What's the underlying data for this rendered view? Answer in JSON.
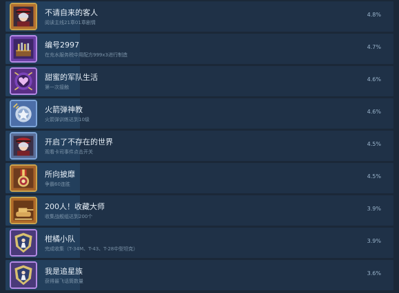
{
  "achievements": [
    {
      "title": "不请自来的客人",
      "desc": "阅读主线21章01章剧情",
      "percent": "4.8%",
      "icon": "officer-portrait-icon"
    },
    {
      "title": "编号2997",
      "desc": "在充水服务税中用配方999x3进行制造",
      "percent": "4.7%",
      "icon": "supply-crate-icon"
    },
    {
      "title": "甜蜜的军队生活",
      "desc": "第一次接触",
      "percent": "4.6%",
      "icon": "purple-heart-emblem-icon"
    },
    {
      "title": "火箭弹神教",
      "desc": "火箭弹训练达到10级",
      "percent": "4.6%",
      "icon": "rocket-medal-icon"
    },
    {
      "title": "开启了不存在的世界",
      "desc": "观看卡司事件点击开关",
      "percent": "4.5%",
      "icon": "officer-portrait-icon"
    },
    {
      "title": "所向披靡",
      "desc": "争霸60连胜",
      "percent": "4.5%",
      "icon": "medal-icon"
    },
    {
      "title": "200人！收藏大师",
      "desc": "收集战舰组达到200个",
      "percent": "3.9%",
      "icon": "tank-emblem-icon"
    },
    {
      "title": "柑橘小队",
      "desc": "完成收集（T-34M、T-43、T-28中型坦克）",
      "percent": "3.9%",
      "icon": "soldier-shield-icon"
    },
    {
      "title": "我是追星族",
      "desc": "获得最飞话筒数量",
      "percent": "3.6%",
      "icon": "soldier-shield-icon"
    }
  ],
  "colors": {
    "background": "#1b2838",
    "row": "#1f3147",
    "progress_fill": "#264a6e",
    "title_text": "#e6eef6",
    "desc_text": "#7b93a8",
    "percent_text": "#9ab4cb"
  }
}
